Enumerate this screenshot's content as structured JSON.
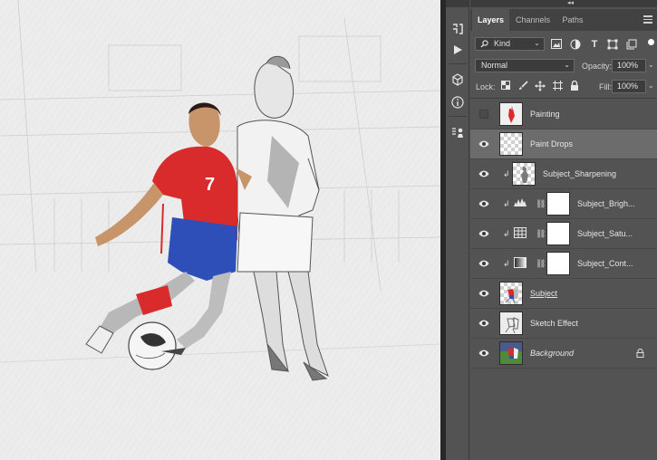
{
  "tools": {
    "items": [
      {
        "icon": "history-icon"
      },
      {
        "icon": "play-action-icon"
      },
      {
        "icon": "3d-cube-icon"
      },
      {
        "icon": "info-icon"
      },
      {
        "icon": "clone-source-icon"
      }
    ]
  },
  "panel": {
    "collapse": "◂◂",
    "tabs": [
      {
        "label": "Layers",
        "active": true
      },
      {
        "label": "Channels",
        "active": false
      },
      {
        "label": "Paths",
        "active": false
      }
    ],
    "filter": {
      "label": "Kind"
    },
    "blend_mode": "Normal",
    "opacity_label": "Opacity:",
    "opacity_value": "100%",
    "lock_label": "Lock:",
    "fill_label": "Fill:",
    "fill_value": "100%"
  },
  "layers": [
    {
      "name": "Painting",
      "visible": false,
      "type": "pixel",
      "thumb": "painting"
    },
    {
      "name": "Paint Drops",
      "visible": true,
      "type": "pixel",
      "thumb": "empty",
      "selected": true
    },
    {
      "name": "Subject_Sharpening",
      "visible": true,
      "type": "clipped-pixel",
      "thumb": "subject-gray"
    },
    {
      "name": "Subject_Brigh...",
      "visible": true,
      "type": "adjustment",
      "icon": "levels-icon"
    },
    {
      "name": "Subject_Satu...",
      "visible": true,
      "type": "adjustment",
      "icon": "hue-sat-icon"
    },
    {
      "name": "Subject_Cont...",
      "visible": true,
      "type": "adjustment",
      "icon": "gradient-map-icon"
    },
    {
      "name": "Subject",
      "visible": true,
      "type": "pixel",
      "thumb": "subject-color",
      "underline": true
    },
    {
      "name": "Sketch Effect",
      "visible": true,
      "type": "pixel",
      "thumb": "sketch"
    },
    {
      "name": "Background",
      "visible": true,
      "type": "background",
      "thumb": "photo",
      "italic": true,
      "locked": true
    }
  ],
  "colors": {
    "panel_bg": "#535353",
    "selected_row": "#6c6c6c",
    "jersey_red": "#d92b2b",
    "shorts_blue": "#2f4fb8"
  }
}
